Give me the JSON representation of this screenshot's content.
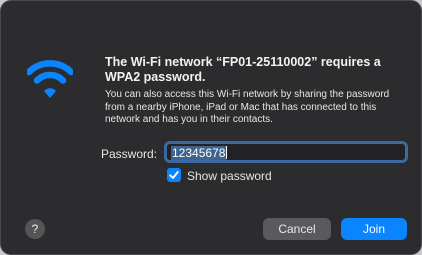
{
  "dialog": {
    "title": "The Wi-Fi network “FP01-25110002” requires a WPA2 password.",
    "description": "You can also access this Wi-Fi network by sharing the password from a nearby iPhone, iPad or Mac that has connected to this network and has you in their contacts.",
    "icon": "wifi-icon",
    "accent_color": "#0a84ff"
  },
  "password": {
    "label": "Password:",
    "value": "12345678"
  },
  "show_password": {
    "label": "Show password",
    "checked": true
  },
  "buttons": {
    "help": "?",
    "cancel": "Cancel",
    "join": "Join"
  }
}
